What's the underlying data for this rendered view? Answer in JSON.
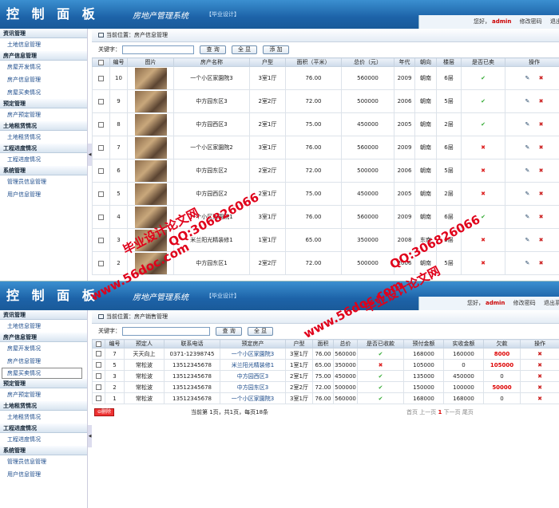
{
  "panel_top": {
    "header": {
      "brand": "控 制 面 板",
      "system": "房地产管理系统",
      "tag": "【毕业设计】",
      "greeting": "您好，",
      "user": "admin",
      "change_pwd": "修改密码",
      "logout": "退出系统"
    },
    "sidebar": [
      {
        "group": "资讯管理",
        "items": [
          "土地信息管理"
        ]
      },
      {
        "group": "房产信息管理",
        "items": [
          "房屋开发情况",
          "房产信息管理",
          "房屋买卖情况"
        ]
      },
      {
        "group": "预定管理",
        "items": [
          "房产预定管理"
        ]
      },
      {
        "group": "土地租赁情况",
        "items": [
          "土地租赁情况"
        ]
      },
      {
        "group": "工程进度情况",
        "items": [
          "工程进度情况"
        ]
      },
      {
        "group": "系统管理",
        "items": [
          "管理员信息管理",
          "用户信息管理"
        ]
      }
    ],
    "location": "当前位置：房产信息管理",
    "search": {
      "label": "关键字：",
      "value": "",
      "query": "查 询",
      "all": "全 显",
      "add": "添 加"
    },
    "columns": [
      "编号",
      "图片",
      "房产名称",
      "户型",
      "面积（平米）",
      "总价（元）",
      "年代",
      "朝向",
      "楼层",
      "是否已卖",
      "操作"
    ],
    "rows": [
      {
        "id": "10",
        "name": "一个小区家園院3",
        "layout": "3室1厅",
        "area": "76.00",
        "price": "560000",
        "year": "2009",
        "dir": "朝南",
        "floor": "6层",
        "sold": true
      },
      {
        "id": "9",
        "name": "中方园东区3",
        "layout": "2室2厅",
        "area": "72.00",
        "price": "500000",
        "year": "2006",
        "dir": "朝南",
        "floor": "5层",
        "sold": true
      },
      {
        "id": "8",
        "name": "中方园西区3",
        "layout": "2室1厅",
        "area": "75.00",
        "price": "450000",
        "year": "2005",
        "dir": "朝南",
        "floor": "2层",
        "sold": true
      },
      {
        "id": "7",
        "name": "一个小区家園院2",
        "layout": "3室1厅",
        "area": "76.00",
        "price": "560000",
        "year": "2009",
        "dir": "朝南",
        "floor": "6层",
        "sold": false
      },
      {
        "id": "6",
        "name": "中方园东区2",
        "layout": "2室2厅",
        "area": "72.00",
        "price": "500000",
        "year": "2006",
        "dir": "朝南",
        "floor": "5层",
        "sold": false
      },
      {
        "id": "5",
        "name": "中方园西区2",
        "layout": "2室1厅",
        "area": "75.00",
        "price": "450000",
        "year": "2005",
        "dir": "朝南",
        "floor": "2层",
        "sold": false
      },
      {
        "id": "4",
        "name": "一个小区家園院1",
        "layout": "3室1厅",
        "area": "76.00",
        "price": "560000",
        "year": "2009",
        "dir": "朝南",
        "floor": "6层",
        "sold": true
      },
      {
        "id": "3",
        "name": "米兰阳光精装修1",
        "layout": "1室1厅",
        "area": "65.00",
        "price": "350000",
        "year": "2008",
        "dir": "东南",
        "floor": "3层",
        "sold": false
      },
      {
        "id": "2",
        "name": "中方园东区1",
        "layout": "2室2厅",
        "area": "72.00",
        "price": "500000",
        "year": "2006",
        "dir": "朝南",
        "floor": "5层",
        "sold": false
      }
    ]
  },
  "panel_bottom": {
    "header": {
      "brand": "控 制 面 板",
      "system": "房地产管理系统",
      "tag": "【毕业设计】",
      "greeting": "您好，",
      "user": "admin",
      "change_pwd": "修改密码",
      "logout": "退出系统"
    },
    "sidebar": [
      {
        "group": "资讯管理",
        "items": [
          "土地信息管理"
        ]
      },
      {
        "group": "房产信息管理",
        "items": [
          "房屋开发情况",
          "房产信息管理",
          "房屋买卖情况"
        ]
      },
      {
        "group": "预定管理",
        "items": [
          "房产预定管理"
        ]
      },
      {
        "group": "土地租赁情况",
        "items": [
          "土地租赁情况"
        ]
      },
      {
        "group": "工程进度情况",
        "items": [
          "工程进度情况"
        ]
      },
      {
        "group": "系统管理",
        "items": [
          "管理员信息管理",
          "用户信息管理"
        ]
      }
    ],
    "location": "当前位置：房产销售管理",
    "search": {
      "label": "关键字：",
      "value": "",
      "query": "查 询",
      "all": "全 显"
    },
    "columns": [
      "编号",
      "预定人",
      "联系电话",
      "预定房产",
      "户型",
      "面积",
      "总价",
      "是否已收款",
      "预付金额",
      "实收金额",
      "欠款",
      "操作"
    ],
    "rows": [
      {
        "id": "7",
        "person": "天天向上",
        "phone": "0371-12398745",
        "house": "一个小区家園院3",
        "layout": "3室1厅",
        "area": "76.00",
        "total": "560000",
        "paid": true,
        "prepay": "168000",
        "actual": "160000",
        "debt": "8000"
      },
      {
        "id": "5",
        "person": "常松波",
        "phone": "13512345678",
        "house": "米兰阳光精装修1",
        "layout": "1室1厅",
        "area": "65.00",
        "total": "350000",
        "paid": false,
        "prepay": "105000",
        "actual": "0",
        "debt": "105000"
      },
      {
        "id": "3",
        "person": "常松波",
        "phone": "13512345678",
        "house": "中方园西区3",
        "layout": "2室1厅",
        "area": "75.00",
        "total": "450000",
        "paid": true,
        "prepay": "135000",
        "actual": "450000",
        "debt": "0"
      },
      {
        "id": "2",
        "person": "常松波",
        "phone": "13512345678",
        "house": "中方园东区3",
        "layout": "2室2厅",
        "area": "72.00",
        "total": "500000",
        "paid": true,
        "prepay": "150000",
        "actual": "100000",
        "debt": "50000"
      },
      {
        "id": "1",
        "person": "常松波",
        "phone": "13512345678",
        "house": "一个小区家園院3",
        "layout": "3室1厅",
        "area": "76.00",
        "total": "560000",
        "paid": true,
        "prepay": "168000",
        "actual": "168000",
        "debt": "0"
      }
    ],
    "footer": {
      "delete": "删除",
      "page_info": "当前第 1页，共1页，每页18条",
      "first": "首页",
      "prev": "上一页",
      "current": "1",
      "next": "下一页",
      "last": "尾页"
    }
  },
  "watermarks": [
    "毕业设计论文网",
    "QQ:306826066",
    "www.56doc.com"
  ]
}
